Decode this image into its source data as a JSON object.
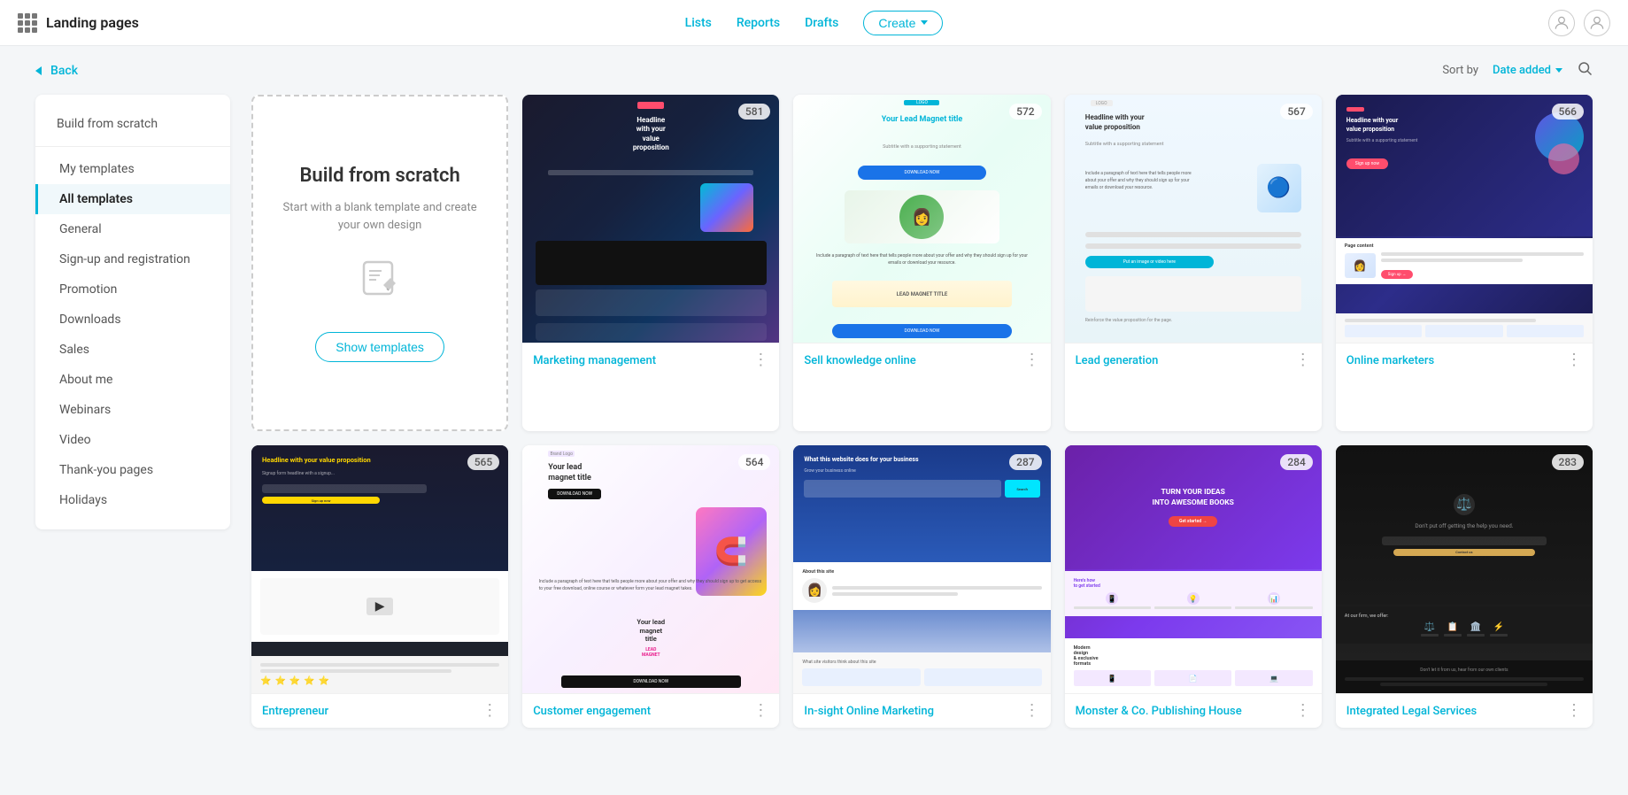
{
  "header": {
    "app_title": "Landing pages",
    "nav": {
      "lists": "Lists",
      "reports": "Reports",
      "drafts": "Drafts",
      "create": "Create"
    }
  },
  "sub_header": {
    "back": "Back",
    "sort_label": "Sort by",
    "sort_value": "Date added"
  },
  "sidebar": {
    "build_label": "Build from scratch",
    "items": [
      {
        "id": "my-templates",
        "label": "My templates",
        "active": false
      },
      {
        "id": "all-templates",
        "label": "All templates",
        "active": true
      },
      {
        "id": "general",
        "label": "General",
        "active": false
      },
      {
        "id": "signup",
        "label": "Sign-up and registration",
        "active": false
      },
      {
        "id": "promotion",
        "label": "Promotion",
        "active": false
      },
      {
        "id": "downloads",
        "label": "Downloads",
        "active": false
      },
      {
        "id": "sales",
        "label": "Sales",
        "active": false
      },
      {
        "id": "about-me",
        "label": "About me",
        "active": false
      },
      {
        "id": "webinars",
        "label": "Webinars",
        "active": false
      },
      {
        "id": "video",
        "label": "Video",
        "active": false
      },
      {
        "id": "thank-you",
        "label": "Thank-you pages",
        "active": false
      },
      {
        "id": "holidays",
        "label": "Holidays",
        "active": false
      }
    ]
  },
  "scratch_card": {
    "title": "Build from scratch",
    "subtitle": "Start with a blank template and create your own design",
    "button": "Show templates"
  },
  "templates": [
    {
      "id": "marketing-mgmt",
      "title": "Marketing management",
      "count": "581",
      "theme": "dark-blue"
    },
    {
      "id": "sell-knowledge",
      "title": "Sell knowledge online",
      "count": "572",
      "theme": "green-white"
    },
    {
      "id": "lead-generation",
      "title": "Lead generation",
      "count": "567",
      "theme": "light-blue"
    },
    {
      "id": "online-marketers",
      "title": "Online marketers",
      "count": "566",
      "theme": "dark-navy"
    },
    {
      "id": "entrepreneur",
      "title": "Entrepreneur",
      "count": "565",
      "theme": "dark"
    },
    {
      "id": "customer-engagement",
      "title": "Customer engagement",
      "count": "564",
      "theme": "pink-purple"
    },
    {
      "id": "insight-online",
      "title": "In-sight Online Marketing",
      "count": "287",
      "theme": "blue-white"
    },
    {
      "id": "monster-publishing",
      "title": "Monster & Co. Publishing House",
      "count": "284",
      "theme": "purple"
    },
    {
      "id": "integrated-legal",
      "title": "Integrated Legal Services",
      "count": "283",
      "theme": "dark-bg"
    }
  ]
}
